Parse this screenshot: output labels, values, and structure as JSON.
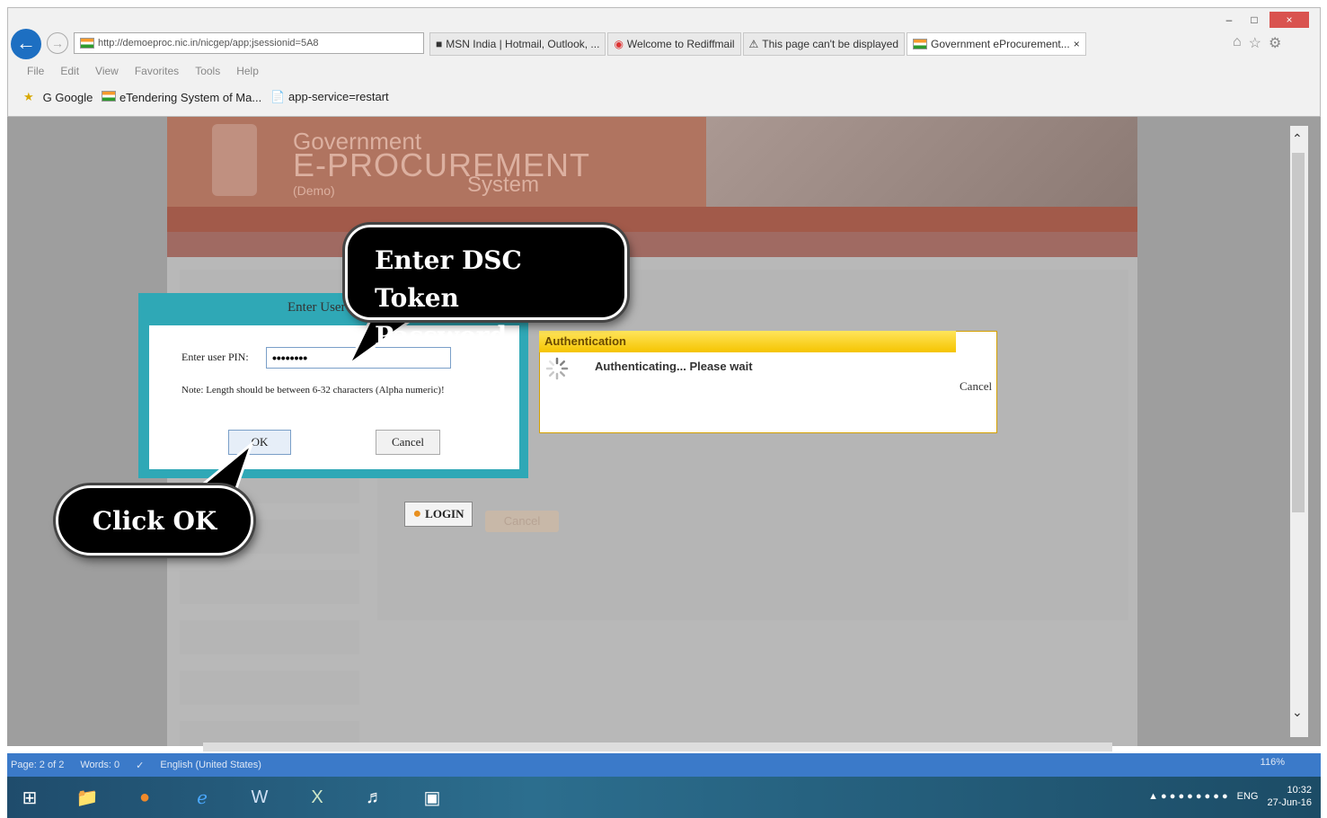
{
  "browser": {
    "address": "http://demoeproc.nic.in/nicgep/app;jsessionid=5A8",
    "tabs": [
      {
        "label": "MSN India | Hotmail, Outlook, ..."
      },
      {
        "label": "Welcome to Rediffmail"
      },
      {
        "label": "This page can't be displayed"
      },
      {
        "label": "Government eProcurement..."
      }
    ],
    "menu": [
      "File",
      "Edit",
      "View",
      "Favorites",
      "Tools",
      "Help"
    ],
    "favorites": [
      "Google",
      "eTendering System of Ma...",
      "app-service=restart"
    ]
  },
  "site": {
    "title_line1": "Government",
    "title_line2": "E-PROCUREMENT",
    "title_demo": "(Demo)",
    "title_system": "System"
  },
  "pin_dialog": {
    "title": "Enter User",
    "label": "Enter user PIN:",
    "value": "••••••••",
    "note": "Note: Length should be between 6-32 characters (Alpha numeric)!",
    "ok": "OK",
    "cancel": "Cancel"
  },
  "auth_dialog": {
    "title": "Authentication",
    "message": "Authenticating... Please wait",
    "cancel": "Cancel"
  },
  "page": {
    "login": "LOGIN",
    "cancel": "Cancel"
  },
  "callouts": {
    "token": "Enter DSC Token Password",
    "ok": "Click OK"
  },
  "word_status": {
    "page": "Page: 2 of 2",
    "words": "Words: 0",
    "language": "English (United States)",
    "zoom": "116%"
  },
  "taskbar": {
    "lang": "ENG",
    "time": "10:32",
    "date": "27-Jun-16"
  }
}
